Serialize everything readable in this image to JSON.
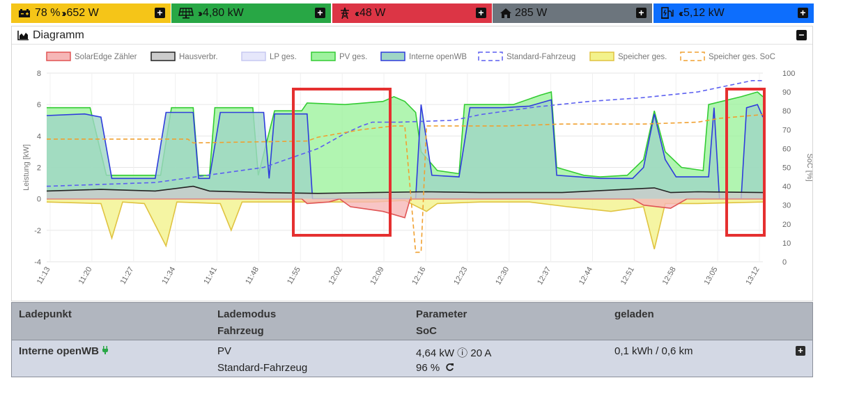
{
  "status": {
    "battery": {
      "soc": "78 %",
      "power": "652 W",
      "color": "#f5c518",
      "icon": "battery-charging-icon"
    },
    "pv": {
      "power": "4,80 kW",
      "color": "#28a745",
      "icon": "solar-panel-icon"
    },
    "grid": {
      "power": "48 W",
      "color": "#dc3545",
      "icon": "power-pole-icon"
    },
    "house": {
      "power": "285 W",
      "color": "#6c757d",
      "icon": "home-icon"
    },
    "chargepoints": {
      "power": "5,12 kW",
      "color": "#0d6efd",
      "icon": "charging-station-icon"
    }
  },
  "diagram": {
    "title": "Diagramm",
    "y_left_label": "Leistung [kW]",
    "y_right_label": "SoC [%]"
  },
  "chart_data": {
    "type": "area",
    "x": [
      "11:13",
      "11:20",
      "11:27",
      "11:34",
      "11:41",
      "11:48",
      "11:55",
      "12:02",
      "12:09",
      "12:16",
      "12:23",
      "12:30",
      "12:37",
      "12:44",
      "12:51",
      "12:58",
      "13:05",
      "13:12"
    ],
    "ylim": [
      -4,
      8
    ],
    "y_ticks": [
      -4,
      -2,
      0,
      2,
      4,
      6,
      8
    ],
    "y2lim": [
      0,
      100
    ],
    "y2_ticks": [
      0,
      10,
      20,
      30,
      40,
      50,
      60,
      70,
      80,
      90,
      100
    ],
    "legend_position": "top",
    "grid": true,
    "series": [
      {
        "name": "SolarEdge Zähler",
        "color": "#e05454",
        "fill": "#f6b6b6",
        "points": [
          [
            0,
            0
          ],
          [
            47,
            0
          ],
          [
            48,
            -0.3
          ],
          [
            52,
            -0.2
          ],
          [
            54,
            0
          ],
          [
            56,
            -0.5
          ],
          [
            62,
            -0.8
          ],
          [
            66,
            -1.2
          ],
          [
            67,
            0
          ],
          [
            68,
            0
          ],
          [
            108,
            0
          ],
          [
            110,
            -0.4
          ],
          [
            115,
            -0.6
          ],
          [
            118,
            0
          ],
          [
            132,
            0
          ]
        ]
      },
      {
        "name": "Hausverbr.",
        "color": "#222222",
        "fill": "#cccccc",
        "points": [
          [
            0,
            0.5
          ],
          [
            10,
            0.6
          ],
          [
            20,
            0.5
          ],
          [
            27,
            0.8
          ],
          [
            30,
            0.5
          ],
          [
            40,
            0.4
          ],
          [
            50,
            0.35
          ],
          [
            60,
            0.4
          ],
          [
            70,
            0.45
          ],
          [
            80,
            0.4
          ],
          [
            95,
            0.4
          ],
          [
            112,
            0.7
          ],
          [
            115,
            0.4
          ],
          [
            120,
            0.45
          ],
          [
            132,
            0.4
          ]
        ]
      },
      {
        "name": "LP ges.",
        "color": "#c7c9f2",
        "fill": "#e6e7fb",
        "points": []
      },
      {
        "name": "PV ges.",
        "color": "#33cc33",
        "fill": "#9ef29e",
        "points": [
          [
            0,
            5.8
          ],
          [
            8,
            5.8
          ],
          [
            11,
            1.5
          ],
          [
            21,
            1.5
          ],
          [
            23,
            5.8
          ],
          [
            27,
            5.8
          ],
          [
            28,
            1.5
          ],
          [
            30,
            1.5
          ],
          [
            31,
            5.8
          ],
          [
            38,
            5.8
          ],
          [
            39,
            1.5
          ],
          [
            42,
            5.6
          ],
          [
            47,
            5.6
          ],
          [
            48,
            6.1
          ],
          [
            55,
            6.0
          ],
          [
            62,
            6.2
          ],
          [
            64,
            6.5
          ],
          [
            66,
            6.2
          ],
          [
            68,
            5.5
          ],
          [
            69,
            3.0
          ],
          [
            72,
            1.8
          ],
          [
            76,
            1.6
          ],
          [
            77,
            6.0
          ],
          [
            86,
            6.0
          ],
          [
            91,
            6.6
          ],
          [
            93,
            6.8
          ],
          [
            94,
            2.0
          ],
          [
            99,
            1.5
          ],
          [
            102,
            1.4
          ],
          [
            107,
            1.5
          ],
          [
            110,
            2.5
          ],
          [
            112,
            5.6
          ],
          [
            114,
            3.0
          ],
          [
            117,
            2.0
          ],
          [
            121,
            1.8
          ],
          [
            122,
            6.0
          ],
          [
            128,
            6.5
          ],
          [
            131,
            6.8
          ],
          [
            132,
            6.5
          ]
        ]
      },
      {
        "name": "Interne openWB",
        "color": "#2e3bdc",
        "fill": "#9fd6c5",
        "points": [
          [
            0,
            5.3
          ],
          [
            7,
            5.4
          ],
          [
            10,
            5.2
          ],
          [
            12,
            1.3
          ],
          [
            20,
            1.3
          ],
          [
            22,
            5.5
          ],
          [
            27,
            5.5
          ],
          [
            28,
            1.3
          ],
          [
            30,
            1.3
          ],
          [
            32,
            5.5
          ],
          [
            40,
            5.5
          ],
          [
            41,
            1.3
          ],
          [
            42,
            5.4
          ],
          [
            48,
            5.4
          ],
          [
            49,
            0
          ],
          [
            68,
            0
          ],
          [
            69,
            6.0
          ],
          [
            71,
            1.5
          ],
          [
            76,
            1.4
          ],
          [
            78,
            5.8
          ],
          [
            84,
            5.8
          ],
          [
            89,
            5.9
          ],
          [
            93,
            6.3
          ],
          [
            94,
            1.5
          ],
          [
            102,
            1.3
          ],
          [
            108,
            1.3
          ],
          [
            110,
            2.0
          ],
          [
            112,
            5.4
          ],
          [
            114,
            2.5
          ],
          [
            116,
            1.4
          ],
          [
            122,
            1.4
          ],
          [
            123,
            5.8
          ],
          [
            124,
            0
          ],
          [
            128,
            0
          ],
          [
            129,
            5.8
          ],
          [
            131,
            6.0
          ],
          [
            132,
            5.2
          ]
        ]
      },
      {
        "name": "Standard-Fahrzeug",
        "color": "#5b5ff0",
        "dash": "6,4",
        "axis": "right",
        "points": [
          [
            0,
            40
          ],
          [
            20,
            42
          ],
          [
            25,
            44
          ],
          [
            30,
            46
          ],
          [
            40,
            50
          ],
          [
            45,
            55
          ],
          [
            50,
            60
          ],
          [
            55,
            68
          ],
          [
            58,
            72
          ],
          [
            60,
            74
          ],
          [
            65,
            74
          ],
          [
            75,
            75
          ],
          [
            80,
            78
          ],
          [
            90,
            82
          ],
          [
            100,
            85
          ],
          [
            110,
            87
          ],
          [
            120,
            90
          ],
          [
            130,
            96
          ],
          [
            132,
            96
          ]
        ]
      },
      {
        "name": "Speicher ges.",
        "color": "#e0c341",
        "fill": "#f3f28c",
        "points": [
          [
            0,
            -0.2
          ],
          [
            10,
            -0.3
          ],
          [
            12,
            -2.5
          ],
          [
            14,
            -0.2
          ],
          [
            18,
            -0.3
          ],
          [
            22,
            -3.0
          ],
          [
            24,
            -0.2
          ],
          [
            32,
            -0.3
          ],
          [
            34,
            -2.0
          ],
          [
            36,
            -0.2
          ],
          [
            60,
            -0.2
          ],
          [
            66,
            -0.1
          ],
          [
            70,
            -0.8
          ],
          [
            72,
            -0.3
          ],
          [
            80,
            -0.2
          ],
          [
            89,
            -0.2
          ],
          [
            96,
            -0.5
          ],
          [
            104,
            -0.8
          ],
          [
            110,
            -0.5
          ],
          [
            112,
            -3.2
          ],
          [
            114,
            -0.3
          ],
          [
            120,
            -0.3
          ],
          [
            132,
            -0.2
          ]
        ]
      },
      {
        "name": "Speicher ges. SoC",
        "color": "#f0a030",
        "dash": "6,4",
        "axis": "right",
        "points": [
          [
            0,
            65
          ],
          [
            26,
            65
          ],
          [
            27,
            63
          ],
          [
            48,
            64
          ],
          [
            50,
            66
          ],
          [
            54,
            68
          ],
          [
            58,
            70
          ],
          [
            64,
            72
          ],
          [
            66,
            72
          ],
          [
            68,
            5
          ],
          [
            69,
            5
          ],
          [
            70,
            72
          ],
          [
            85,
            72
          ],
          [
            95,
            73
          ],
          [
            110,
            73
          ],
          [
            120,
            74
          ],
          [
            124,
            76
          ],
          [
            132,
            78
          ]
        ]
      }
    ]
  },
  "table": {
    "headers": {
      "col1": "Ladepunkt",
      "col2_top": "Lademodus",
      "col2_bottom": "Fahrzeug",
      "col3_top": "Parameter",
      "col3_bottom": "SoC",
      "col4": "geladen"
    },
    "rows": [
      {
        "name": "Interne openWB",
        "mode": "PV",
        "vehicle": "Standard-Fahrzeug",
        "parameter": "4,64 kW ⓘ 20 A",
        "soc": "96 %",
        "charged": "0,1 kWh / 0,6 km"
      }
    ]
  }
}
